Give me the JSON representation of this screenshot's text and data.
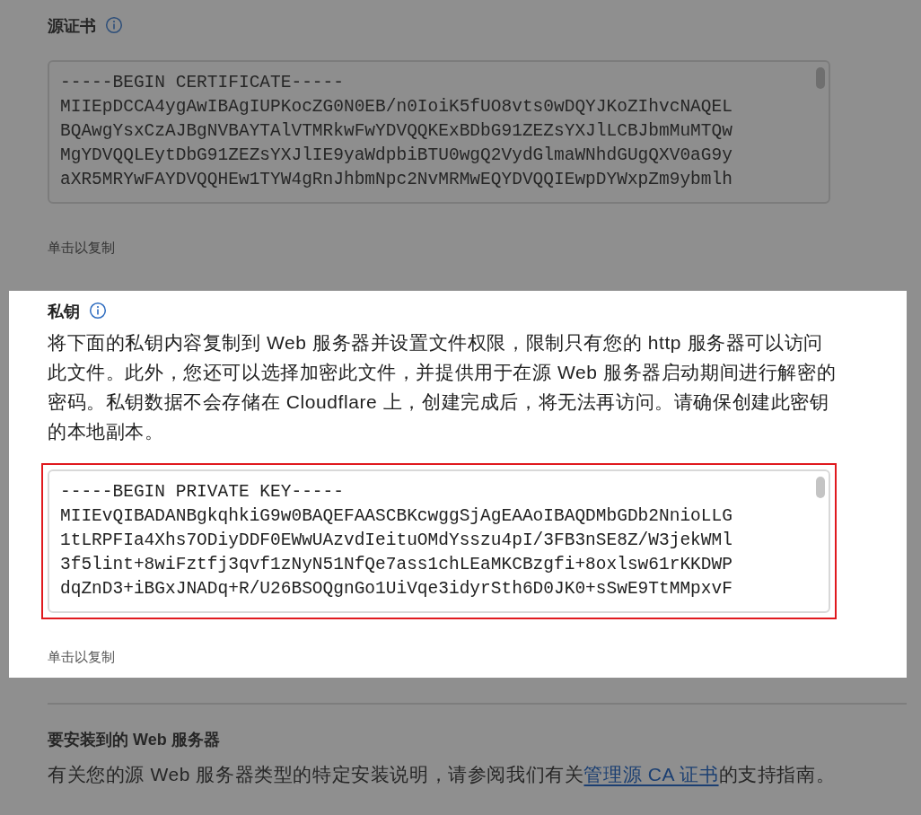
{
  "sections": [
    {
      "kind": "certificate",
      "title": "源证书",
      "spotlight": false,
      "field": {
        "outlined": false,
        "lines": [
          "-----BEGIN CERTIFICATE-----",
          "MIIEpDCCA4ygAwIBAgIUPKocZG0N0EB/n0IoiK5fUO8vts0wDQYJKoZIhvcNAQEL",
          "BQAwgYsxCzAJBgNVBAYTAlVTMRkwFwYDVQQKExBDbG91ZEZsYXJlLCBJbmMuMTQw",
          "MgYDVQQLEytDbG91ZEZsYXJlIE9yaWdpbiBTU0wgQ2VydGlmaWNhdGUgQXV0aG9y",
          "aXR5MRYwFAYDVQQHEw1TYW4gRnJhbmNpc2NvMRMwEQYDVQQIEwpDYWxpZm9ybmlh"
        ]
      },
      "copy_hint": "单击以复制"
    },
    {
      "kind": "key",
      "title": "私钥",
      "spotlight": true,
      "description": "将下面的私钥内容复制到 Web 服务器并设置文件权限，限制只有您的 http 服务器可以访问此文件。此外，您还可以选择加密此文件，并提供用于在源 Web 服务器启动期间进行解密的密码。私钥数据不会存储在 Cloudflare 上，创建完成后，将无法再访问。请确保创建此密钥的本地副本。",
      "field": {
        "outlined": true,
        "lines": [
          "-----BEGIN PRIVATE KEY-----",
          "MIIEvQIBADANBgkqhkiG9w0BAQEFAASCBKcwggSjAgEAAoIBAQDMbGDb2NnioLLG",
          "1tLRPFIa4Xhs7ODiyDDF0EWwUAzvdIeituOMdYsszu4pI/3FB3nSE8Z/W3jekWMl",
          "3f5lint+8wiFztfj3qvf1zNyN51NfQe7ass1chLEaMKCBzgfi+8oxlsw61rKKDWP",
          "dqZnD3+iBGxJNADq+R/U26BSOQgnGo1UiVqe3idyrSth6D0JK0+sSwE9TtMMpxvF"
        ]
      },
      "copy_hint": "单击以复制"
    },
    {
      "kind": "install",
      "title": "要安装到的 Web 服务器",
      "spotlight": false,
      "description_before": "有关您的源 Web 服务器类型的特定安装说明，请参阅我们有关",
      "link": "管理源 CA 证书",
      "description_after": "的支持指南。"
    }
  ]
}
